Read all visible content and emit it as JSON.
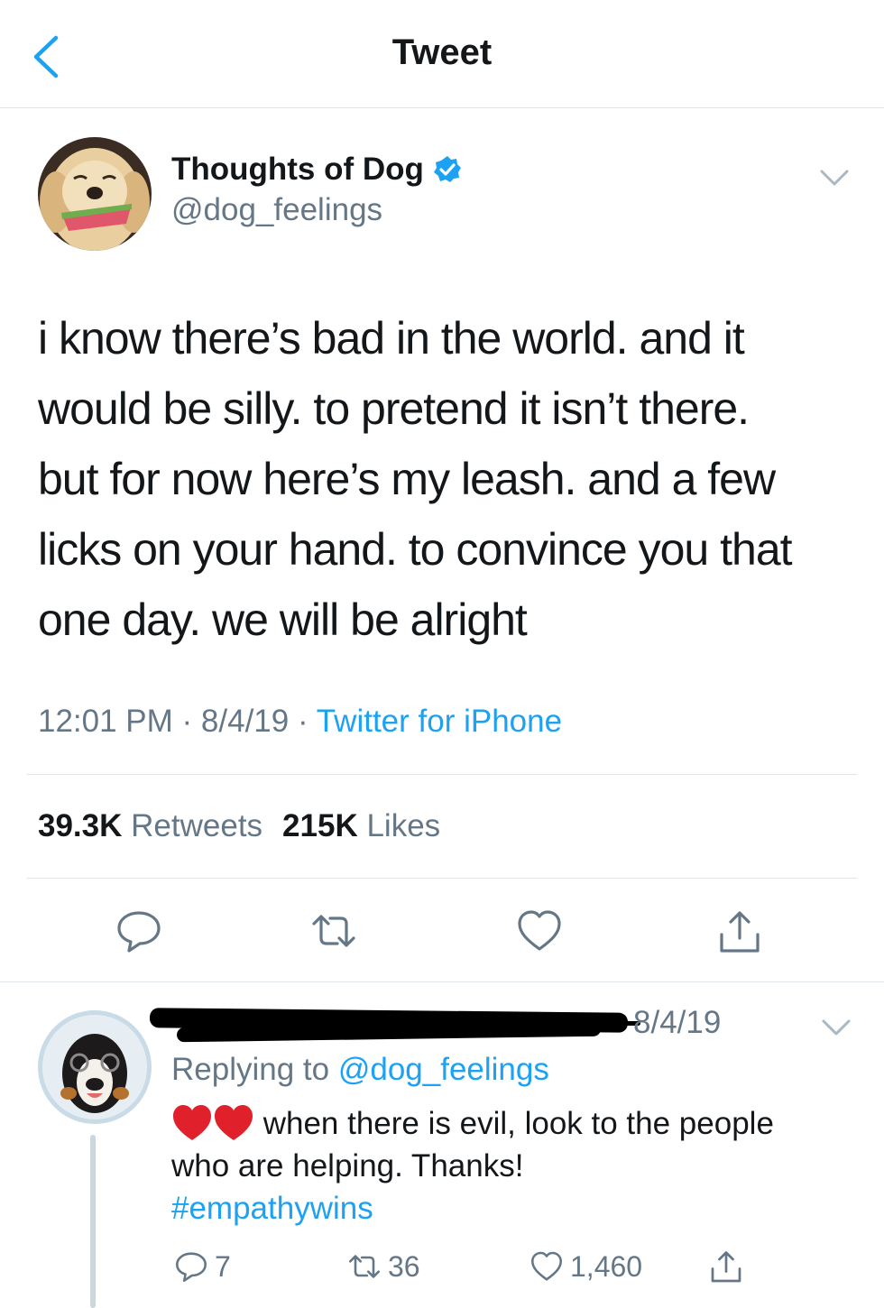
{
  "header": {
    "title": "Tweet"
  },
  "tweet": {
    "author_name": "Thoughts of Dog",
    "handle": "@dog_feelings",
    "text_lines": [
      "i know there’s bad in the world. and it",
      "would be silly. to pretend it isn’t there.",
      "but for now here’s my leash. and a few",
      "licks on your hand. to convince you that",
      "one day. we will be alright"
    ],
    "time": "12:01 PM",
    "date": "8/4/19",
    "separator": " · ",
    "source": "Twitter for iPhone",
    "retweets_count": "39.3K",
    "retweets_label": "Retweets",
    "likes_count": "215K",
    "likes_label": "Likes"
  },
  "reply": {
    "date": "8/4/19",
    "replying_prefix": "Replying to ",
    "replying_handle": "@dog_feelings",
    "text_1": " when there is evil, look to the people",
    "text_2": "who are helping.  Thanks!",
    "hashtag": "#empathywins",
    "reply_count": "7",
    "retweet_count": "36",
    "like_count": "1,460"
  },
  "colors": {
    "accent": "#1da1f2",
    "secondary": "#657786",
    "text": "#14171a",
    "divider": "#e1e6ea"
  },
  "icons": [
    "back-chevron-icon",
    "verified-badge-icon",
    "caret-down-icon",
    "reply-icon",
    "retweet-icon",
    "like-icon",
    "share-icon",
    "heart-emoji-icon"
  ]
}
